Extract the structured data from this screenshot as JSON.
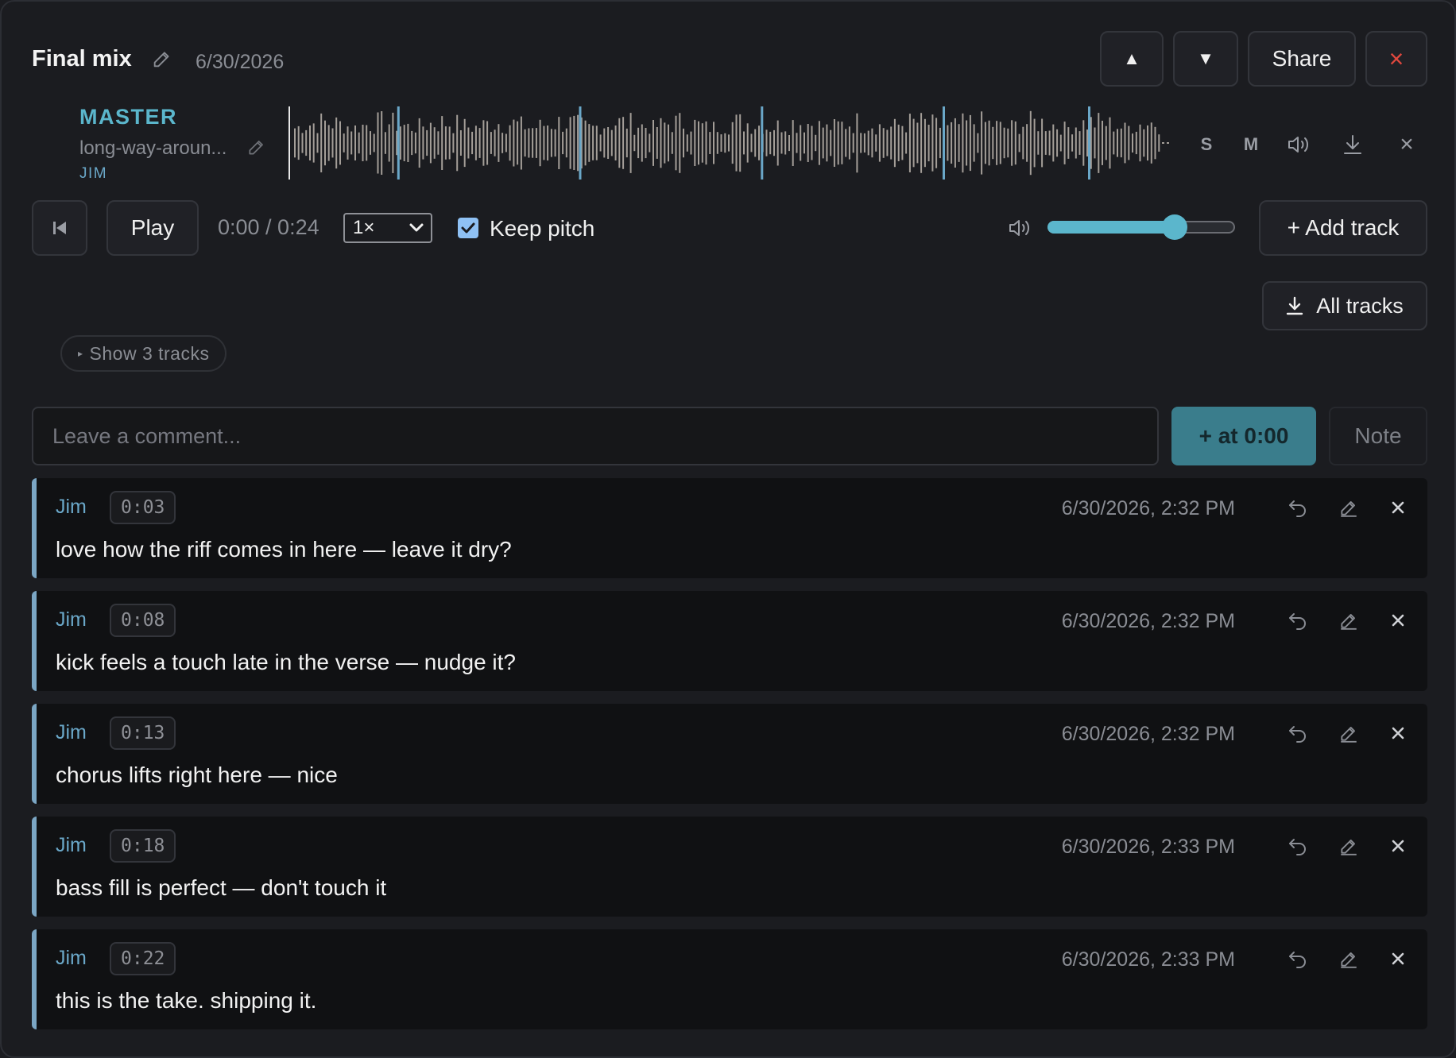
{
  "header": {
    "title": "Final mix",
    "date": "6/30/2026",
    "up_label": "▲",
    "down_label": "▼",
    "share_label": "Share",
    "close_label": "×"
  },
  "track": {
    "name": "MASTER",
    "file": "long-way-aroun...",
    "owner": "JIM",
    "solo_label": "S",
    "mute_label": "M",
    "close_label": "×"
  },
  "transport": {
    "play_label": "Play",
    "time": "0:00 / 0:24",
    "speed": "1×",
    "keep_pitch_label": "Keep pitch",
    "keep_pitch_checked": true,
    "volume": 0.68,
    "add_track_label": "+ Add track",
    "all_tracks_label": "All tracks"
  },
  "show_tracks_label": "Show 3 tracks",
  "comment_box": {
    "placeholder": "Leave a comment...",
    "at_label": "+ at 0:00",
    "note_label": "Note"
  },
  "comments": [
    {
      "author": "Jim",
      "stamp": "0:03",
      "date": "6/30/2026, 2:32 PM",
      "text": "love how the riff comes in here — leave it dry?"
    },
    {
      "author": "Jim",
      "stamp": "0:08",
      "date": "6/30/2026, 2:32 PM",
      "text": "kick feels a touch late in the verse — nudge it?"
    },
    {
      "author": "Jim",
      "stamp": "0:13",
      "date": "6/30/2026, 2:32 PM",
      "text": "chorus lifts right here — nice"
    },
    {
      "author": "Jim",
      "stamp": "0:18",
      "date": "6/30/2026, 2:33 PM",
      "text": "bass fill is perfect — don't touch it"
    },
    {
      "author": "Jim",
      "stamp": "0:22",
      "date": "6/30/2026, 2:33 PM",
      "text": "this is the take. shipping it."
    }
  ],
  "waveform": {
    "duration_s": 24,
    "marker_times_s": [
      3,
      8,
      13,
      18,
      22
    ]
  },
  "colors": {
    "accent": "#5bb6cc",
    "author": "#6aa7c8",
    "marker": "#6aa7c8",
    "close": "#e0483e"
  },
  "icons": [
    "pencil-icon",
    "skip-back-icon",
    "speaker-icon",
    "download-icon",
    "reply-icon",
    "close-icon",
    "check-icon",
    "chevron-down-icon"
  ]
}
